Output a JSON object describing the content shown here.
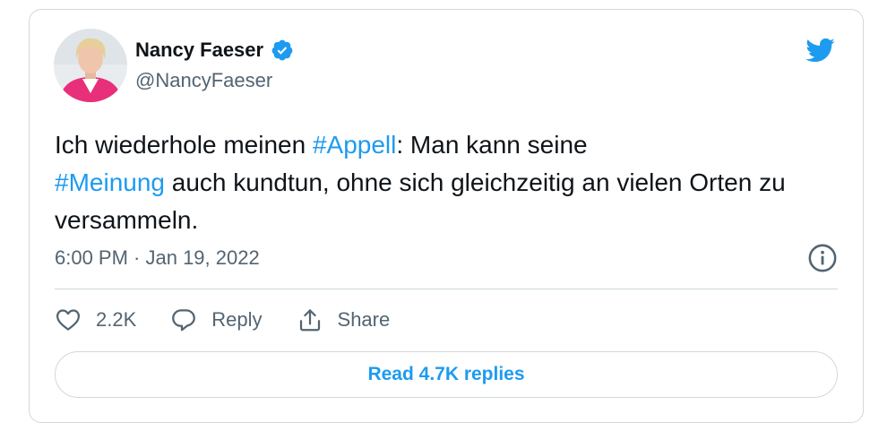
{
  "author": {
    "display_name": "Nancy Faeser",
    "handle": "@NancyFaeser",
    "verified": true
  },
  "tweet": {
    "segments": [
      {
        "type": "text",
        "value": "Ich wiederhole meinen "
      },
      {
        "type": "hashtag",
        "value": "#Appell"
      },
      {
        "type": "text",
        "value": ": Man kann seine "
      },
      {
        "type": "hashtag",
        "value": "#Meinung"
      },
      {
        "type": "text",
        "value": " auch kundtun, ohne sich gleichzeitig an vielen Orten zu versammeln."
      }
    ]
  },
  "meta": {
    "timestamp": "6:00 PM · Jan 19, 2022"
  },
  "actions": {
    "like_count": "2.2K",
    "reply_label": "Reply",
    "share_label": "Share"
  },
  "read_replies_label": "Read 4.7K replies",
  "icons": {
    "brand": "twitter-bird-icon",
    "verified": "verified-badge-icon",
    "info": "info-icon",
    "like": "heart-icon",
    "reply": "speech-bubble-icon",
    "share": "share-upload-icon"
  },
  "colors": {
    "accent": "#1d9bf0",
    "text_primary": "#0f1419",
    "text_secondary": "#536471",
    "border": "#cfd9de"
  }
}
